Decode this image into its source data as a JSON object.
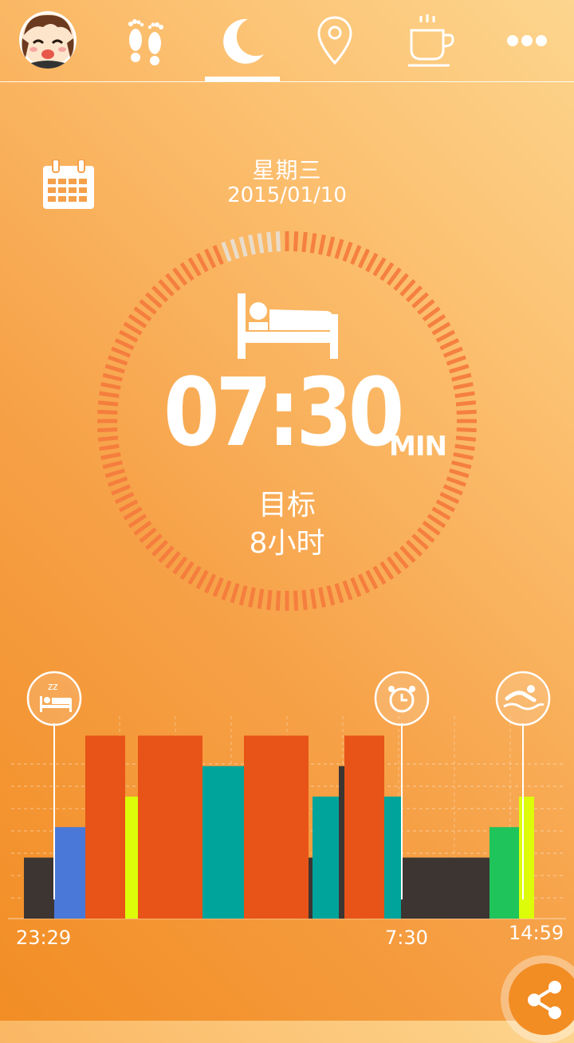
{
  "nav": {
    "items": [
      {
        "icon": "avatar"
      },
      {
        "icon": "footprints-icon"
      },
      {
        "icon": "moon-icon",
        "active": true
      },
      {
        "icon": "location-pin-icon"
      },
      {
        "icon": "coffee-cup-icon"
      },
      {
        "icon": "more-dots-icon"
      }
    ]
  },
  "header": {
    "weekday": "星期三",
    "date": "2015/01/10"
  },
  "summary": {
    "time": "07:30",
    "unit": "MIN",
    "goal_label": "目标",
    "goal_value": "8小时",
    "progress_fraction": 0.9375
  },
  "timeline": {
    "start_label": "23:29",
    "wake_label": "7:30",
    "end_label": "14:59",
    "markers": [
      {
        "icon": "sleep-bed-icon"
      },
      {
        "icon": "alarm-clock-icon"
      },
      {
        "icon": "swimming-icon"
      }
    ]
  },
  "colors": {
    "ring_active": "#f57a3c",
    "ring_inactive": "#e8e3dc",
    "deep": "#e85417",
    "light": "#00a49a",
    "awake": "#3c3532",
    "rem": "#4a78d8",
    "yellow": "#dcfc0a",
    "green": "#1fc45a"
  },
  "chart_data": {
    "type": "bar",
    "series": [
      {
        "value": 3,
        "color": "awake"
      },
      {
        "value": 4.5,
        "color": "rem"
      },
      {
        "value": 9,
        "color": "deep"
      },
      {
        "value": 6,
        "color": "yellow"
      },
      {
        "value": 9,
        "color": "deep"
      },
      {
        "value": 7.5,
        "color": "light"
      },
      {
        "value": 9,
        "color": "deep"
      },
      {
        "value": 3,
        "color": "awake"
      },
      {
        "value": 6,
        "color": "light"
      },
      {
        "value": 7.5,
        "color": "awake"
      },
      {
        "value": 9,
        "color": "deep"
      },
      {
        "value": 6,
        "color": "light"
      },
      {
        "value": 3,
        "color": "awake"
      },
      {
        "value": 4.5,
        "color": "green"
      },
      {
        "value": 6,
        "color": "yellow"
      }
    ]
  },
  "actions": {
    "share": "share-icon"
  }
}
